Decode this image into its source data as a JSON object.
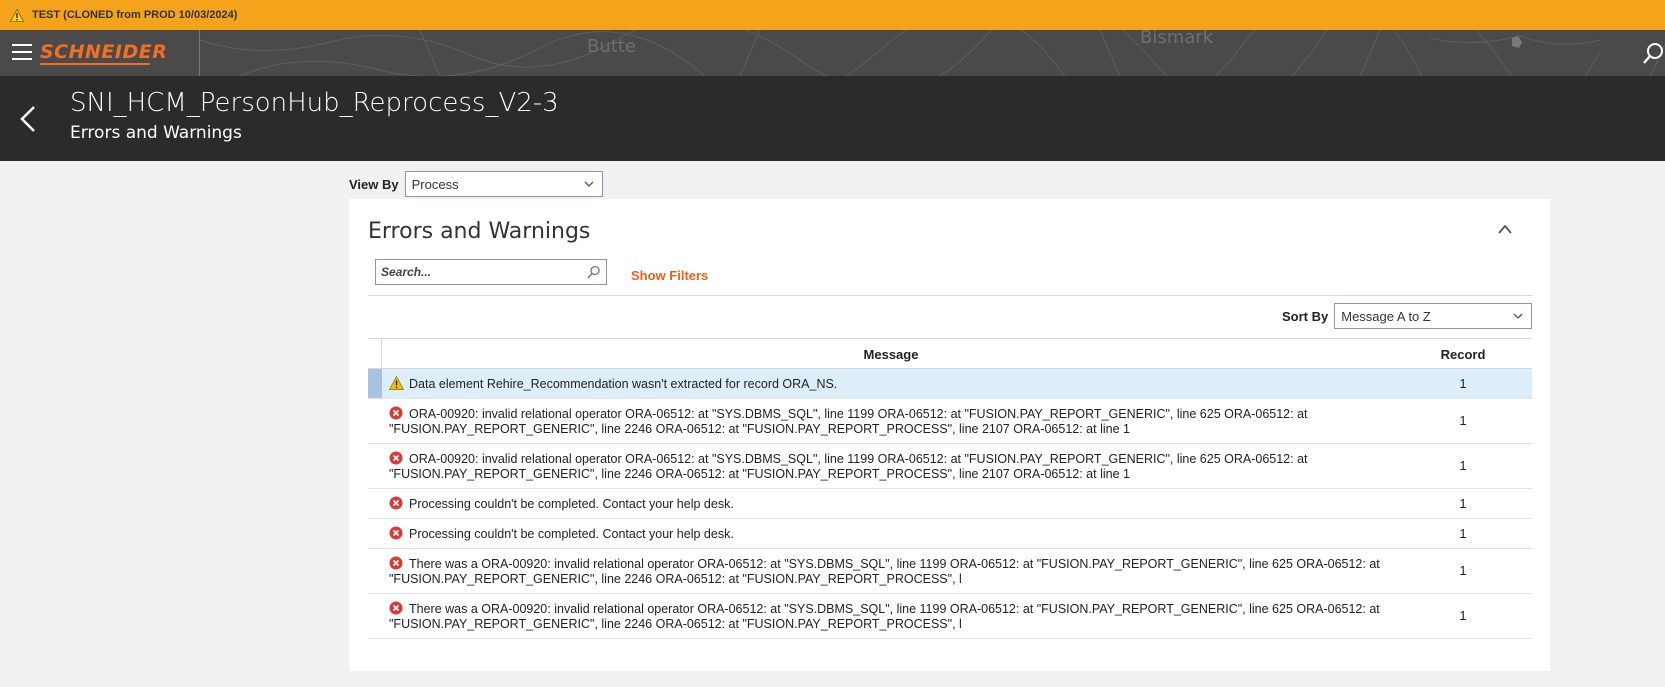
{
  "banner": {
    "text": "TEST (CLONED from PROD 10/03/2024)"
  },
  "header": {
    "logo": "SCHNEIDER",
    "map_labels": [
      "Butte",
      "Bismark"
    ]
  },
  "page": {
    "title": "SNI_HCM_PersonHub_Reprocess_V2-3",
    "subtitle": "Errors and Warnings"
  },
  "view_by": {
    "label": "View By",
    "value": "Process"
  },
  "panel": {
    "title": "Errors and Warnings",
    "search_placeholder": "Search...",
    "show_filters": "Show Filters",
    "sort_by": {
      "label": "Sort By",
      "value": "Message A to Z"
    }
  },
  "table": {
    "columns": {
      "message": "Message",
      "record": "Record"
    },
    "rows": [
      {
        "type": "warning",
        "message": "Data element Rehire_Recommendation wasn't extracted for record ORA_NS.",
        "record": "1"
      },
      {
        "type": "error",
        "message": "ORA-00920: invalid relational operator ORA-06512: at \"SYS.DBMS_SQL\", line 1199 ORA-06512: at \"FUSION.PAY_REPORT_GENERIC\", line 625 ORA-06512: at \"FUSION.PAY_REPORT_GENERIC\", line 2246 ORA-06512: at \"FUSION.PAY_REPORT_PROCESS\", line 2107 ORA-06512: at line 1",
        "record": "1"
      },
      {
        "type": "error",
        "message": "ORA-00920: invalid relational operator ORA-06512: at \"SYS.DBMS_SQL\", line 1199 ORA-06512: at \"FUSION.PAY_REPORT_GENERIC\", line 625 ORA-06512: at \"FUSION.PAY_REPORT_GENERIC\", line 2246 ORA-06512: at \"FUSION.PAY_REPORT_PROCESS\", line 2107 ORA-06512: at line 1",
        "record": "1"
      },
      {
        "type": "error",
        "message": "Processing couldn't be completed. Contact your help desk.",
        "record": "1"
      },
      {
        "type": "error",
        "message": "Processing couldn't be completed. Contact your help desk.",
        "record": "1"
      },
      {
        "type": "error",
        "message": "There was a ORA-00920: invalid relational operator ORA-06512: at \"SYS.DBMS_SQL\", line 1199 ORA-06512: at \"FUSION.PAY_REPORT_GENERIC\", line 625 ORA-06512: at \"FUSION.PAY_REPORT_GENERIC\", line 2246 ORA-06512: at \"FUSION.PAY_REPORT_PROCESS\", l",
        "record": "1"
      },
      {
        "type": "error",
        "message": "There was a ORA-00920: invalid relational operator ORA-06512: at \"SYS.DBMS_SQL\", line 1199 ORA-06512: at \"FUSION.PAY_REPORT_GENERIC\", line 625 ORA-06512: at \"FUSION.PAY_REPORT_GENERIC\", line 2246 ORA-06512: at \"FUSION.PAY_REPORT_PROCESS\", l",
        "record": "1"
      }
    ]
  },
  "colors": {
    "banner": "#f6a31c",
    "brand": "#f36f21",
    "link": "#e8601c",
    "header_dark": "#2b2b2b",
    "selected_row": "#ddeefb",
    "error": "#d63b3b",
    "warning": "#f2c200"
  }
}
